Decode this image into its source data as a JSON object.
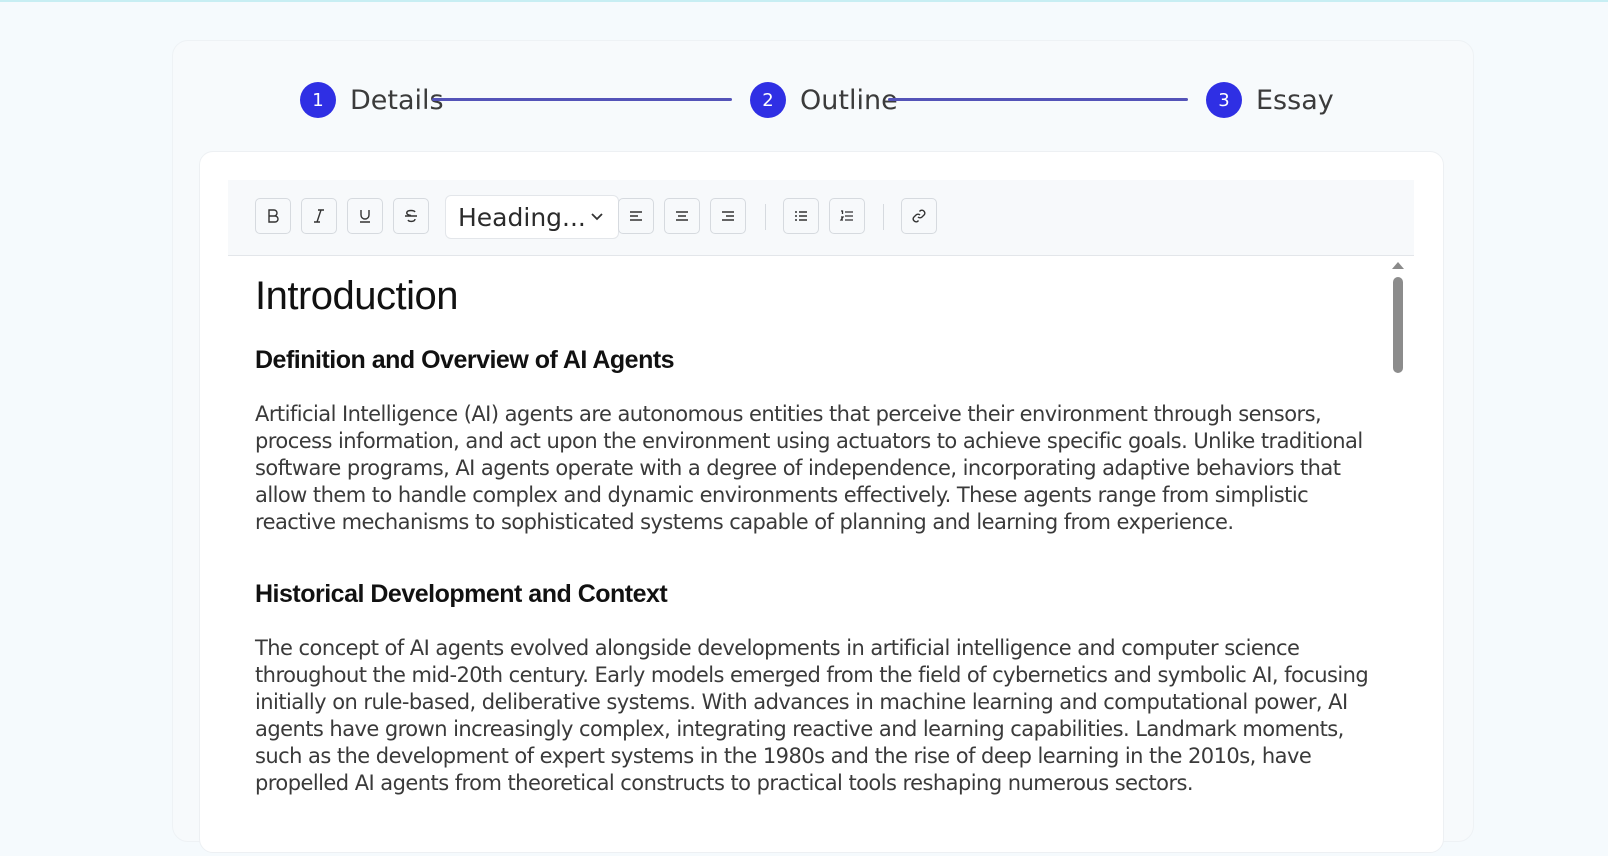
{
  "stepper": {
    "steps": [
      {
        "number": "1",
        "label": "Details"
      },
      {
        "number": "2",
        "label": "Outline"
      },
      {
        "number": "3",
        "label": "Essay"
      }
    ]
  },
  "toolbar": {
    "buttons": [
      "bold-icon",
      "italic-icon",
      "underline-icon",
      "strikethrough-icon",
      "align-left-icon",
      "align-center-icon",
      "align-right-icon",
      "bullet-list-icon",
      "ordered-list-icon",
      "link-icon"
    ],
    "heading_select": "Heading..."
  },
  "document": {
    "title": "Introduction",
    "sections": [
      {
        "heading": "Definition and Overview of AI Agents",
        "paragraph": "Artificial Intelligence (AI) agents are autonomous entities that perceive their environment through sensors, process information, and act upon the environment using actuators to achieve specific goals. Unlike traditional software programs, AI agents operate with a degree of independence, incorporating adaptive behaviors that allow them to handle complex and dynamic environments effectively. These agents range from simplistic reactive mechanisms to sophisticated systems capable of planning and learning from experience."
      },
      {
        "heading": "Historical Development and Context",
        "paragraph": "The concept of AI agents evolved alongside developments in artificial intelligence and computer science throughout the mid-20th century. Early models emerged from the field of cybernetics and symbolic AI, focusing initially on rule-based, deliberative systems. With advances in machine learning and computational power, AI agents have grown increasingly complex, integrating reactive and learning capabilities. Landmark moments, such as the development of expert systems in the 1980s and the rise of deep learning in the 2010s, have propelled AI agents from theoretical constructs to practical tools reshaping numerous sectors."
      }
    ]
  },
  "colors": {
    "accent": "#2f2fe4",
    "stepper_line": "#5453b8",
    "background": "#f5fafd"
  }
}
